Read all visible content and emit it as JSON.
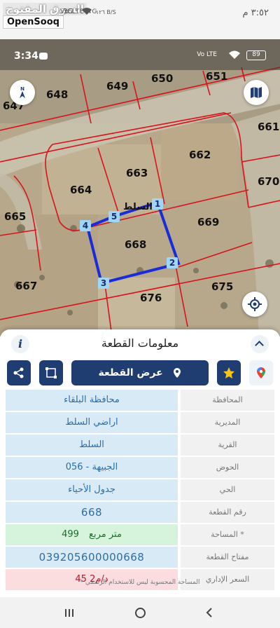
{
  "outer_status": {
    "watermark_text": "السوق المفتوح",
    "watermark_brand": "OpenSooq",
    "signal_text": "Vo LTE 4G",
    "network_text": "3G",
    "speed_text": "١٢٦\nB/S",
    "time": "٣:٥٢ م"
  },
  "map": {
    "inner_time": "3:34",
    "inner_network": "Vo LTE",
    "battery_level": "89",
    "plots": [
      {
        "num": "648"
      },
      {
        "num": "649"
      },
      {
        "num": "650"
      },
      {
        "num": "651"
      },
      {
        "num": "647"
      },
      {
        "num": "661"
      },
      {
        "num": "662"
      },
      {
        "num": "663"
      },
      {
        "num": "664"
      },
      {
        "num": "670"
      },
      {
        "num": "665"
      },
      {
        "num": "669"
      },
      {
        "num": "668"
      },
      {
        "num": "667"
      },
      {
        "num": "675"
      },
      {
        "num": "676"
      }
    ],
    "plot_inline_label": "السلط",
    "vertices": [
      "1",
      "2",
      "3",
      "4",
      "5"
    ]
  },
  "panel": {
    "title": "معلومات القطعة",
    "info_icon": "i",
    "show_plot_label": "عرض القطعة",
    "rows": [
      {
        "label": "المحافظة",
        "value": "محافظة البلقاء"
      },
      {
        "label": "المديرية",
        "value": "اراضي السلط"
      },
      {
        "label": "القرية",
        "value": "السلط"
      },
      {
        "label": "الحوض",
        "value": "الجبيهة - 056"
      },
      {
        "label": "الحي",
        "value": "جدول الأحياء"
      },
      {
        "label": "رقم القطعة",
        "value": "668"
      },
      {
        "label": "المساحة *",
        "value_num": "499",
        "value_unit": "متر مربع"
      },
      {
        "label": "مفتاح القطعة",
        "value": "039205600000668"
      },
      {
        "label": "السعر الإداري",
        "value": "45 د/م2"
      }
    ],
    "footnote": "* المساحة المحسوبة ليس للاستخدام الرسمي"
  },
  "colors": {
    "accent": "#1f3d70",
    "value_bg": "#d8eaf5",
    "green_bg": "#d6f3db",
    "red_bg": "#fbdde0",
    "plot_outline": "#1a2bd8",
    "parcel_lines": "#d9121b"
  }
}
